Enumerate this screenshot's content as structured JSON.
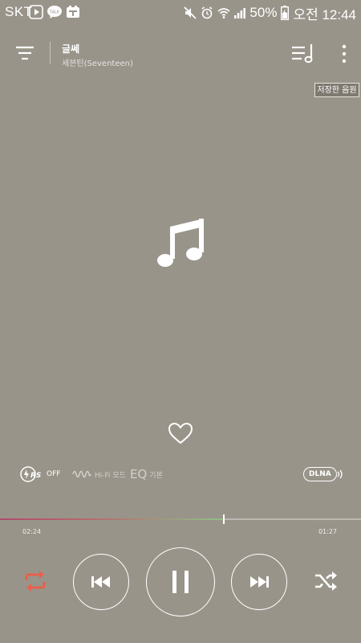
{
  "status_bar": {
    "carrier": "SKT",
    "battery": "50%",
    "time": "오전 12:44",
    "icons": [
      "play-store-icon",
      "kakao-talk-icon",
      "app-notification-icon",
      "mute-icon",
      "alarm-icon",
      "wifi-icon",
      "signal-icon",
      "battery-icon"
    ]
  },
  "header": {
    "song_title": "글쎄",
    "artist": "세븐틴(Seventeen)",
    "icons": [
      "menu-filter-icon",
      "playlist-icon",
      "more-vert-icon"
    ]
  },
  "saved_badge": "저장한 음원",
  "album_art": {
    "icon": "music-note-icon"
  },
  "features": {
    "rs_label": "OFF",
    "hifi_label": "Hi-Fi 모드",
    "eq_big": "EQ",
    "eq_small": "기본",
    "dlna_label": "DLNA"
  },
  "progress": {
    "elapsed": "02:24",
    "remaining": "01:27",
    "fraction": 0.62
  },
  "controls": {
    "repeat_color": "#e8604c",
    "icons": [
      "repeat-icon",
      "previous-icon",
      "pause-icon",
      "next-icon",
      "shuffle-icon"
    ]
  }
}
